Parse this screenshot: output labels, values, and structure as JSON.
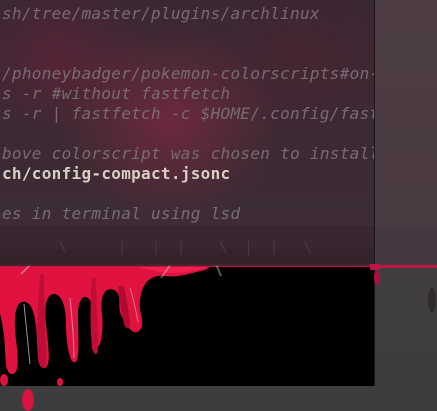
{
  "terminal": {
    "lines": [
      "sh/tree/master/plugins/archlinux",
      "/phoneybadger/pokemon-colorscripts#on-other-",
      "s -r #without fastfetch",
      "s -r | fastfetch -c $HOME/.config/fastfetch/",
      "bove colorscript was chosen to install",
      "ch/config-compact.jsonc",
      "es in terminal using lsd"
    ]
  },
  "wallpaper": {
    "accent_color": "#c01445",
    "description_icon": "blood-drip-art"
  },
  "colors": {
    "terminal_bg": "#3a2832",
    "comment_text": "#7a6b72",
    "bright_text": "#d9d0c4",
    "blood": "#e0123f"
  }
}
